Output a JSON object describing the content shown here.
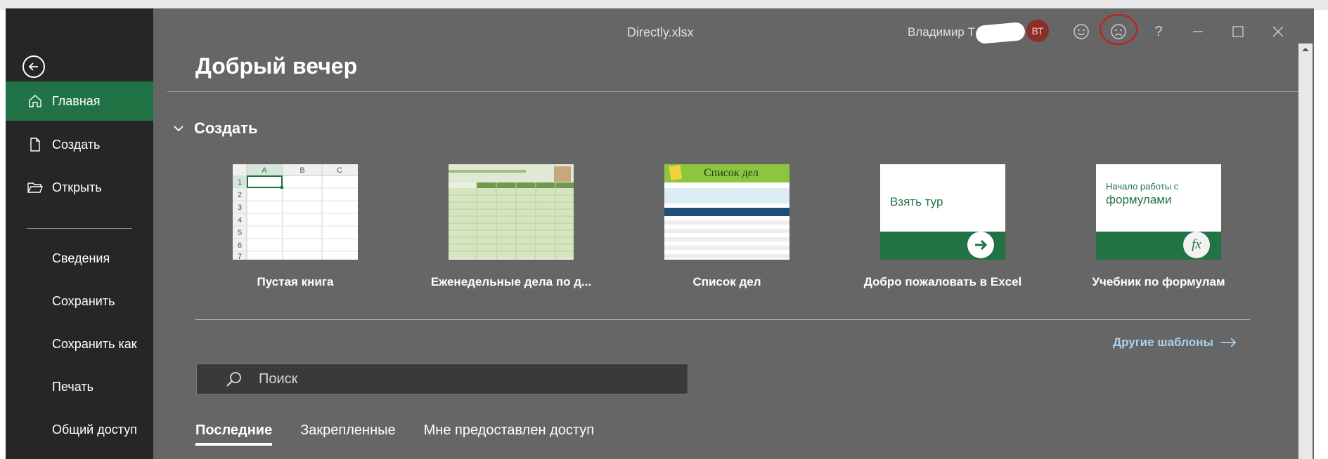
{
  "window": {
    "title": "Directly.xlsx",
    "user_name": "Владимир Т",
    "avatar_initials": "ВТ",
    "avatar_color": "#8b2e25",
    "icons": [
      "smile-icon",
      "frown-icon",
      "help-icon",
      "minimize-icon",
      "maximize-icon",
      "close-icon"
    ],
    "help_label": "?"
  },
  "sidebar": {
    "background": "#262626",
    "active_color": "#217346",
    "primary": [
      {
        "label": "Главная",
        "icon": "home-icon",
        "active": true
      },
      {
        "label": "Создать",
        "icon": "new-document-icon"
      },
      {
        "label": "Открыть",
        "icon": "open-folder-icon"
      }
    ],
    "secondary": [
      {
        "label": "Сведения"
      },
      {
        "label": "Сохранить"
      },
      {
        "label": "Сохранить как"
      },
      {
        "label": "Печать"
      },
      {
        "label": "Общий доступ"
      }
    ]
  },
  "main": {
    "greeting": "Добрый вечер",
    "section_title": "Создать",
    "templates": [
      {
        "label": "Пустая книга"
      },
      {
        "label": "Еженедельные дела по д..."
      },
      {
        "label": "Список дел",
        "thumb_title": "Список дел"
      },
      {
        "label": "Добро пожаловать в Excel",
        "thumb_title": "Взять тур"
      },
      {
        "label": "Учебник по формулам",
        "thumb_title_line1": "Начало работы с",
        "thumb_title_line2": "формулами",
        "thumb_badge": "fx"
      }
    ],
    "blank_sheet": {
      "columns": [
        "A",
        "B",
        "C"
      ],
      "rows": [
        "1",
        "2",
        "3",
        "4",
        "5",
        "6",
        "7"
      ]
    },
    "more_templates": "Другие шаблоны",
    "search_placeholder": "Поиск",
    "tabs": [
      {
        "label": "Последние",
        "active": true
      },
      {
        "label": "Закрепленные"
      },
      {
        "label": "Мне предоставлен доступ"
      }
    ],
    "accent_green": "#217346",
    "link_color": "#a8d2f0"
  }
}
